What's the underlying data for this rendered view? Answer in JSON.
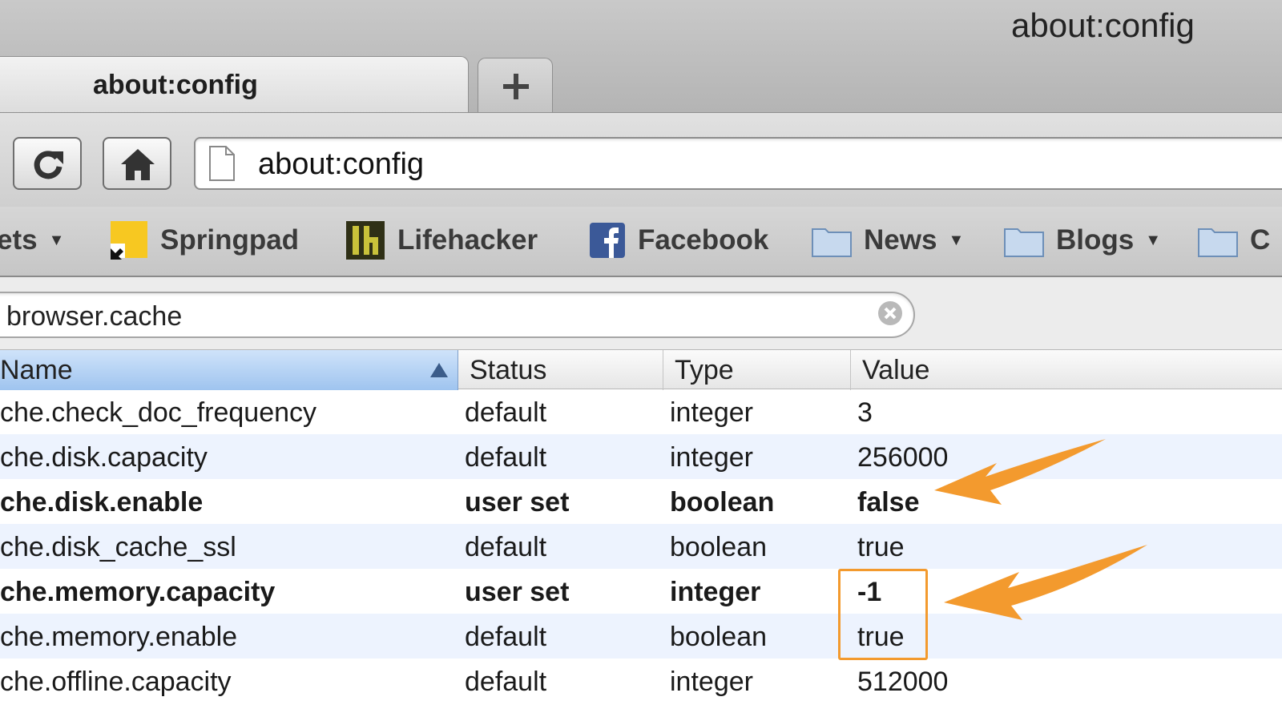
{
  "window": {
    "title": "about:config"
  },
  "tabs": [
    {
      "label": "about:config",
      "active": true
    }
  ],
  "new_tab_label": "+",
  "navbar": {
    "url": "about:config"
  },
  "bookmarks": [
    {
      "label": "ets",
      "type": "folder-menu",
      "icon": "none"
    },
    {
      "label": "Springpad",
      "type": "link",
      "icon": "springpad-icon"
    },
    {
      "label": "Lifehacker",
      "type": "link",
      "icon": "lifehacker-icon"
    },
    {
      "label": "Facebook",
      "type": "link",
      "icon": "facebook-icon"
    },
    {
      "label": "News",
      "type": "folder-menu",
      "icon": "folder-icon"
    },
    {
      "label": "Blogs",
      "type": "folder-menu",
      "icon": "folder-icon"
    },
    {
      "label": "C",
      "type": "folder-menu",
      "icon": "folder-icon"
    }
  ],
  "filter": {
    "value": "browser.cache"
  },
  "table": {
    "columns": [
      "Name",
      "Status",
      "Type",
      "Value"
    ],
    "sort_column": "Name",
    "sort_direction": "ascending",
    "rows": [
      {
        "name": "che.check_doc_frequency",
        "status": "default",
        "type": "integer",
        "value": "3"
      },
      {
        "name": "che.disk.capacity",
        "status": "default",
        "type": "integer",
        "value": "256000"
      },
      {
        "name": "che.disk.enable",
        "status": "user set",
        "type": "boolean",
        "value": "false"
      },
      {
        "name": "che.disk_cache_ssl",
        "status": "default",
        "type": "boolean",
        "value": "true"
      },
      {
        "name": "che.memory.capacity",
        "status": "user set",
        "type": "integer",
        "value": "-1"
      },
      {
        "name": "che.memory.enable",
        "status": "default",
        "type": "boolean",
        "value": "true"
      },
      {
        "name": "che.offline.capacity",
        "status": "default",
        "type": "integer",
        "value": "512000"
      }
    ]
  },
  "colors": {
    "annotation": "#f39a2e",
    "header_selected": "#9fc4ef",
    "row_alt": "#edf3fe"
  }
}
